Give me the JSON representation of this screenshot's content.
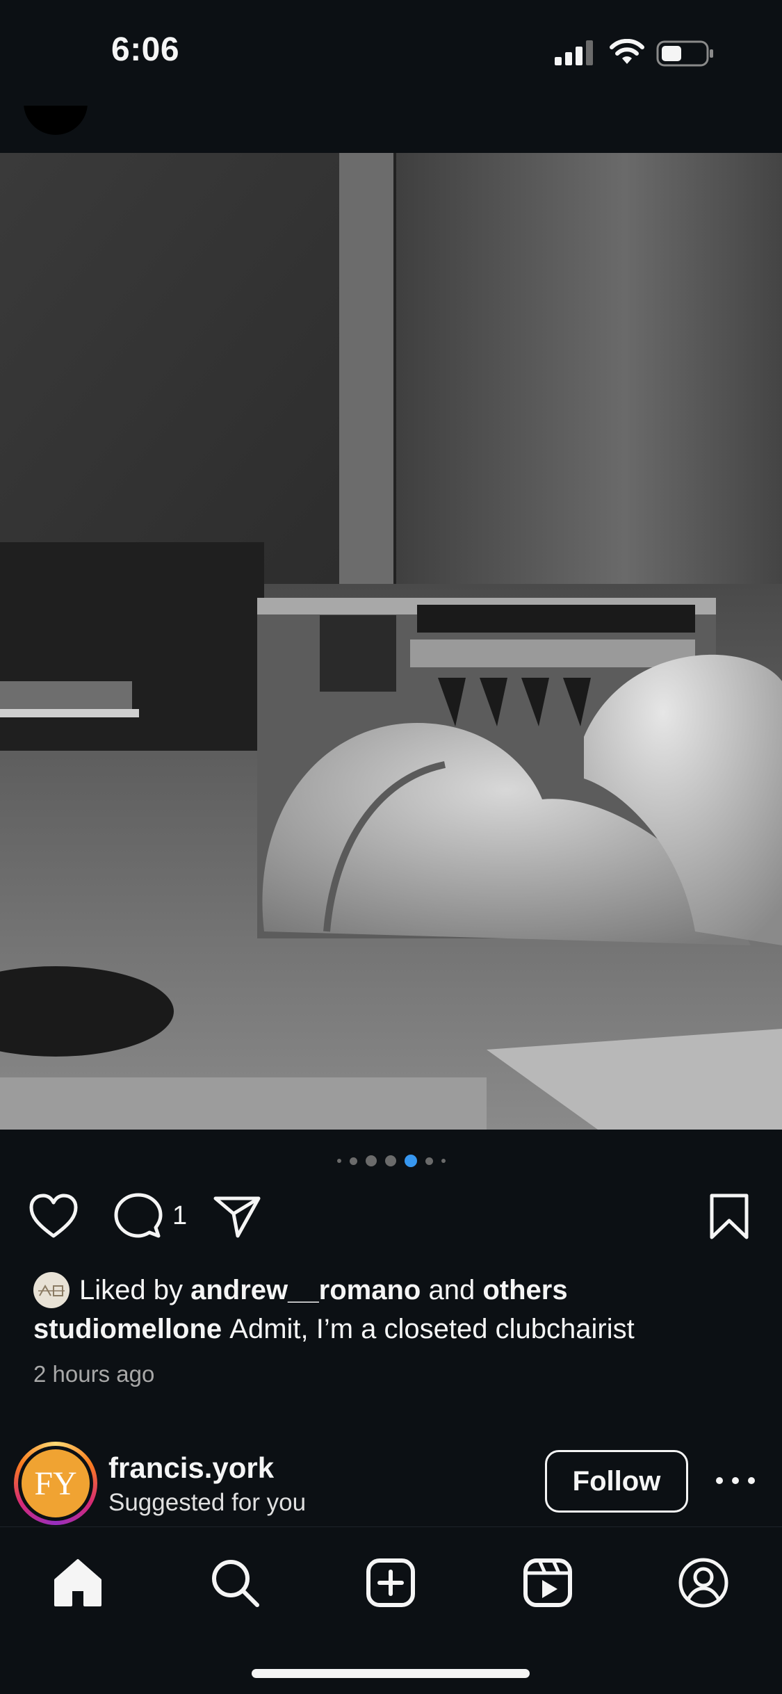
{
  "status_bar": {
    "time": "6:06"
  },
  "post": {
    "carousel": {
      "count": 7,
      "active_index": 4
    },
    "comment_count": "1",
    "liked_by": {
      "prefix": "Liked by",
      "user": "andrew__romano",
      "connector": "and",
      "others": "others"
    },
    "caption": {
      "username": "studiomellone",
      "text": "Admit, I’m a closeted clubchairist"
    },
    "timestamp": "2 hours ago",
    "liker_avatar_text": "AR"
  },
  "suggested": {
    "initials": "FY",
    "username": "francis.york",
    "subtitle": "Suggested for you",
    "follow_label": "Follow"
  },
  "icons": {
    "status": [
      "signal-icon",
      "wifi-icon",
      "battery-icon"
    ],
    "actions": [
      "heart-icon",
      "comment-icon",
      "share-icon",
      "bookmark-icon"
    ],
    "tabs": [
      "home-icon",
      "search-icon",
      "create-icon",
      "reels-icon",
      "profile-icon"
    ]
  },
  "colors": {
    "background": "#0c1014",
    "active_dot": "#3797f0",
    "avatar_orange": "#f0a332"
  }
}
